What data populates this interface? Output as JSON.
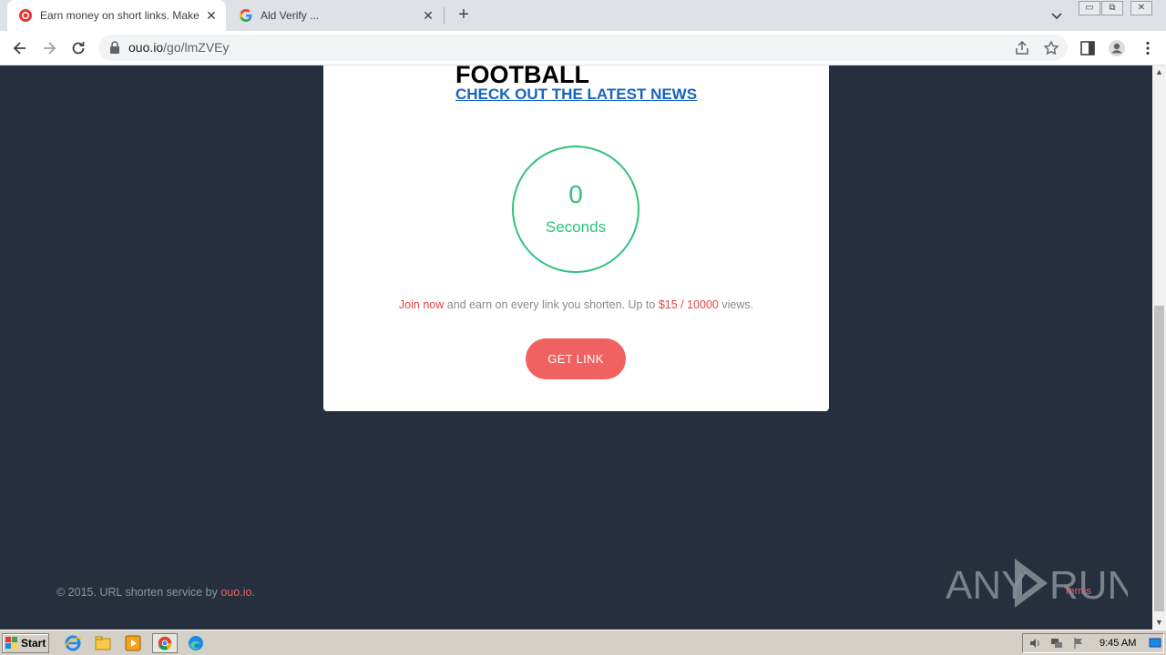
{
  "browser": {
    "tabs": [
      {
        "title": "Earn money on short links. Make sho",
        "active": true
      },
      {
        "title": "Ald Verify ...",
        "active": false
      }
    ],
    "url_host": "ouo.io",
    "url_path": "/go/lmZVEy",
    "accent_color": "#1a73e8"
  },
  "page": {
    "ad_title": "FOOTBALL",
    "ad_link": "CHECK OUT THE LATEST NEWS",
    "timer_value": "0",
    "timer_unit": "Seconds",
    "promo": {
      "join": "Join now",
      "middle": " and earn on every link you shorten. Up to ",
      "rate": "$15 / 10000",
      "end": " views."
    },
    "get_link_label": "GET LINK",
    "footer_prefix": "© 2015. URL shorten service by ",
    "footer_brand": "ouo.io",
    "footer_suffix": ".",
    "terms_label": "Terms",
    "colors": {
      "timer": "#2ec27e",
      "button": "#f26161",
      "background": "#252f3e"
    }
  },
  "watermark": "ANY RUN",
  "taskbar": {
    "start_label": "Start",
    "clock": "9:45 AM"
  }
}
